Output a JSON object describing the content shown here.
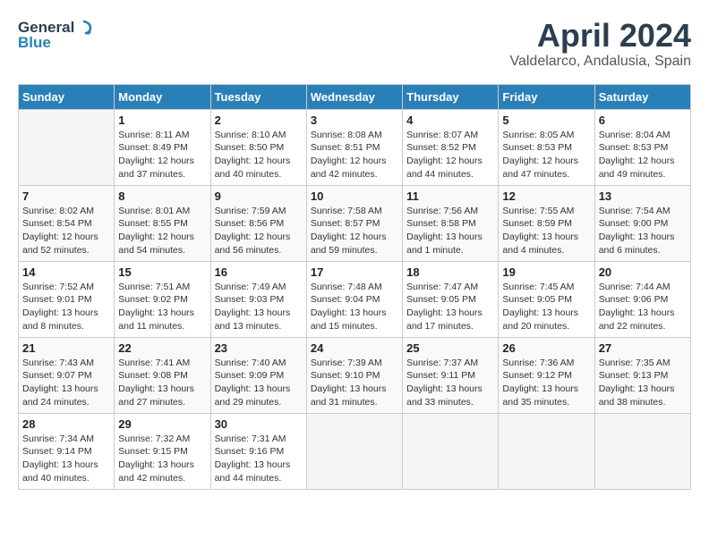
{
  "logo": {
    "line1": "General",
    "line2": "Blue"
  },
  "title": "April 2024",
  "location": "Valdelarco, Andalusia, Spain",
  "days_of_week": [
    "Sunday",
    "Monday",
    "Tuesday",
    "Wednesday",
    "Thursday",
    "Friday",
    "Saturday"
  ],
  "weeks": [
    [
      {
        "day": "",
        "sunrise": "",
        "sunset": "",
        "daylight": ""
      },
      {
        "day": "1",
        "sunrise": "Sunrise: 8:11 AM",
        "sunset": "Sunset: 8:49 PM",
        "daylight": "Daylight: 12 hours and 37 minutes."
      },
      {
        "day": "2",
        "sunrise": "Sunrise: 8:10 AM",
        "sunset": "Sunset: 8:50 PM",
        "daylight": "Daylight: 12 hours and 40 minutes."
      },
      {
        "day": "3",
        "sunrise": "Sunrise: 8:08 AM",
        "sunset": "Sunset: 8:51 PM",
        "daylight": "Daylight: 12 hours and 42 minutes."
      },
      {
        "day": "4",
        "sunrise": "Sunrise: 8:07 AM",
        "sunset": "Sunset: 8:52 PM",
        "daylight": "Daylight: 12 hours and 44 minutes."
      },
      {
        "day": "5",
        "sunrise": "Sunrise: 8:05 AM",
        "sunset": "Sunset: 8:53 PM",
        "daylight": "Daylight: 12 hours and 47 minutes."
      },
      {
        "day": "6",
        "sunrise": "Sunrise: 8:04 AM",
        "sunset": "Sunset: 8:53 PM",
        "daylight": "Daylight: 12 hours and 49 minutes."
      }
    ],
    [
      {
        "day": "7",
        "sunrise": "Sunrise: 8:02 AM",
        "sunset": "Sunset: 8:54 PM",
        "daylight": "Daylight: 12 hours and 52 minutes."
      },
      {
        "day": "8",
        "sunrise": "Sunrise: 8:01 AM",
        "sunset": "Sunset: 8:55 PM",
        "daylight": "Daylight: 12 hours and 54 minutes."
      },
      {
        "day": "9",
        "sunrise": "Sunrise: 7:59 AM",
        "sunset": "Sunset: 8:56 PM",
        "daylight": "Daylight: 12 hours and 56 minutes."
      },
      {
        "day": "10",
        "sunrise": "Sunrise: 7:58 AM",
        "sunset": "Sunset: 8:57 PM",
        "daylight": "Daylight: 12 hours and 59 minutes."
      },
      {
        "day": "11",
        "sunrise": "Sunrise: 7:56 AM",
        "sunset": "Sunset: 8:58 PM",
        "daylight": "Daylight: 13 hours and 1 minute."
      },
      {
        "day": "12",
        "sunrise": "Sunrise: 7:55 AM",
        "sunset": "Sunset: 8:59 PM",
        "daylight": "Daylight: 13 hours and 4 minutes."
      },
      {
        "day": "13",
        "sunrise": "Sunrise: 7:54 AM",
        "sunset": "Sunset: 9:00 PM",
        "daylight": "Daylight: 13 hours and 6 minutes."
      }
    ],
    [
      {
        "day": "14",
        "sunrise": "Sunrise: 7:52 AM",
        "sunset": "Sunset: 9:01 PM",
        "daylight": "Daylight: 13 hours and 8 minutes."
      },
      {
        "day": "15",
        "sunrise": "Sunrise: 7:51 AM",
        "sunset": "Sunset: 9:02 PM",
        "daylight": "Daylight: 13 hours and 11 minutes."
      },
      {
        "day": "16",
        "sunrise": "Sunrise: 7:49 AM",
        "sunset": "Sunset: 9:03 PM",
        "daylight": "Daylight: 13 hours and 13 minutes."
      },
      {
        "day": "17",
        "sunrise": "Sunrise: 7:48 AM",
        "sunset": "Sunset: 9:04 PM",
        "daylight": "Daylight: 13 hours and 15 minutes."
      },
      {
        "day": "18",
        "sunrise": "Sunrise: 7:47 AM",
        "sunset": "Sunset: 9:05 PM",
        "daylight": "Daylight: 13 hours and 17 minutes."
      },
      {
        "day": "19",
        "sunrise": "Sunrise: 7:45 AM",
        "sunset": "Sunset: 9:05 PM",
        "daylight": "Daylight: 13 hours and 20 minutes."
      },
      {
        "day": "20",
        "sunrise": "Sunrise: 7:44 AM",
        "sunset": "Sunset: 9:06 PM",
        "daylight": "Daylight: 13 hours and 22 minutes."
      }
    ],
    [
      {
        "day": "21",
        "sunrise": "Sunrise: 7:43 AM",
        "sunset": "Sunset: 9:07 PM",
        "daylight": "Daylight: 13 hours and 24 minutes."
      },
      {
        "day": "22",
        "sunrise": "Sunrise: 7:41 AM",
        "sunset": "Sunset: 9:08 PM",
        "daylight": "Daylight: 13 hours and 27 minutes."
      },
      {
        "day": "23",
        "sunrise": "Sunrise: 7:40 AM",
        "sunset": "Sunset: 9:09 PM",
        "daylight": "Daylight: 13 hours and 29 minutes."
      },
      {
        "day": "24",
        "sunrise": "Sunrise: 7:39 AM",
        "sunset": "Sunset: 9:10 PM",
        "daylight": "Daylight: 13 hours and 31 minutes."
      },
      {
        "day": "25",
        "sunrise": "Sunrise: 7:37 AM",
        "sunset": "Sunset: 9:11 PM",
        "daylight": "Daylight: 13 hours and 33 minutes."
      },
      {
        "day": "26",
        "sunrise": "Sunrise: 7:36 AM",
        "sunset": "Sunset: 9:12 PM",
        "daylight": "Daylight: 13 hours and 35 minutes."
      },
      {
        "day": "27",
        "sunrise": "Sunrise: 7:35 AM",
        "sunset": "Sunset: 9:13 PM",
        "daylight": "Daylight: 13 hours and 38 minutes."
      }
    ],
    [
      {
        "day": "28",
        "sunrise": "Sunrise: 7:34 AM",
        "sunset": "Sunset: 9:14 PM",
        "daylight": "Daylight: 13 hours and 40 minutes."
      },
      {
        "day": "29",
        "sunrise": "Sunrise: 7:32 AM",
        "sunset": "Sunset: 9:15 PM",
        "daylight": "Daylight: 13 hours and 42 minutes."
      },
      {
        "day": "30",
        "sunrise": "Sunrise: 7:31 AM",
        "sunset": "Sunset: 9:16 PM",
        "daylight": "Daylight: 13 hours and 44 minutes."
      },
      {
        "day": "",
        "sunrise": "",
        "sunset": "",
        "daylight": ""
      },
      {
        "day": "",
        "sunrise": "",
        "sunset": "",
        "daylight": ""
      },
      {
        "day": "",
        "sunrise": "",
        "sunset": "",
        "daylight": ""
      },
      {
        "day": "",
        "sunrise": "",
        "sunset": "",
        "daylight": ""
      }
    ]
  ]
}
